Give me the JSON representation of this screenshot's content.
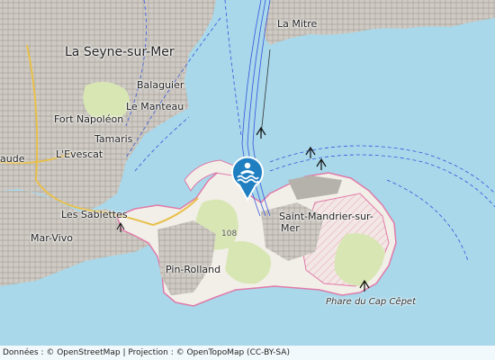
{
  "map": {
    "colors": {
      "sea": "#a8d8ea",
      "land": "#f2efe9",
      "urban": "#c8c4be",
      "green": "#d8e6b4",
      "shipping": "#3355dd",
      "marker": "#1f7fc1",
      "boundary": "#e07aa8"
    },
    "places": {
      "la_seyne": "La Seyne-sur-Mer",
      "balaguier": "Balaguier",
      "le_manteau": "Le Manteau",
      "fort_napoleon": "Fort Napoléon",
      "tamaris": "Tamaris",
      "levescat": "L'Evescat",
      "laude": "aude",
      "les_sablettes": "Les Sablettes",
      "mar_vivo": "Mar-Vivo",
      "pin_rolland": "Pin-Rolland",
      "la_mitre": "La Mitre",
      "saint_mandrier": "Saint-Mandrier-sur-",
      "saint_mandrier_2": "Mer",
      "phare": "Phare du Cap Cêpet",
      "elevation": "108"
    },
    "marker_icon": "swimming-icon"
  },
  "attribution": "Données : © OpenStreetMap | Projection : © OpenTopoMap (CC-BY-SA)"
}
